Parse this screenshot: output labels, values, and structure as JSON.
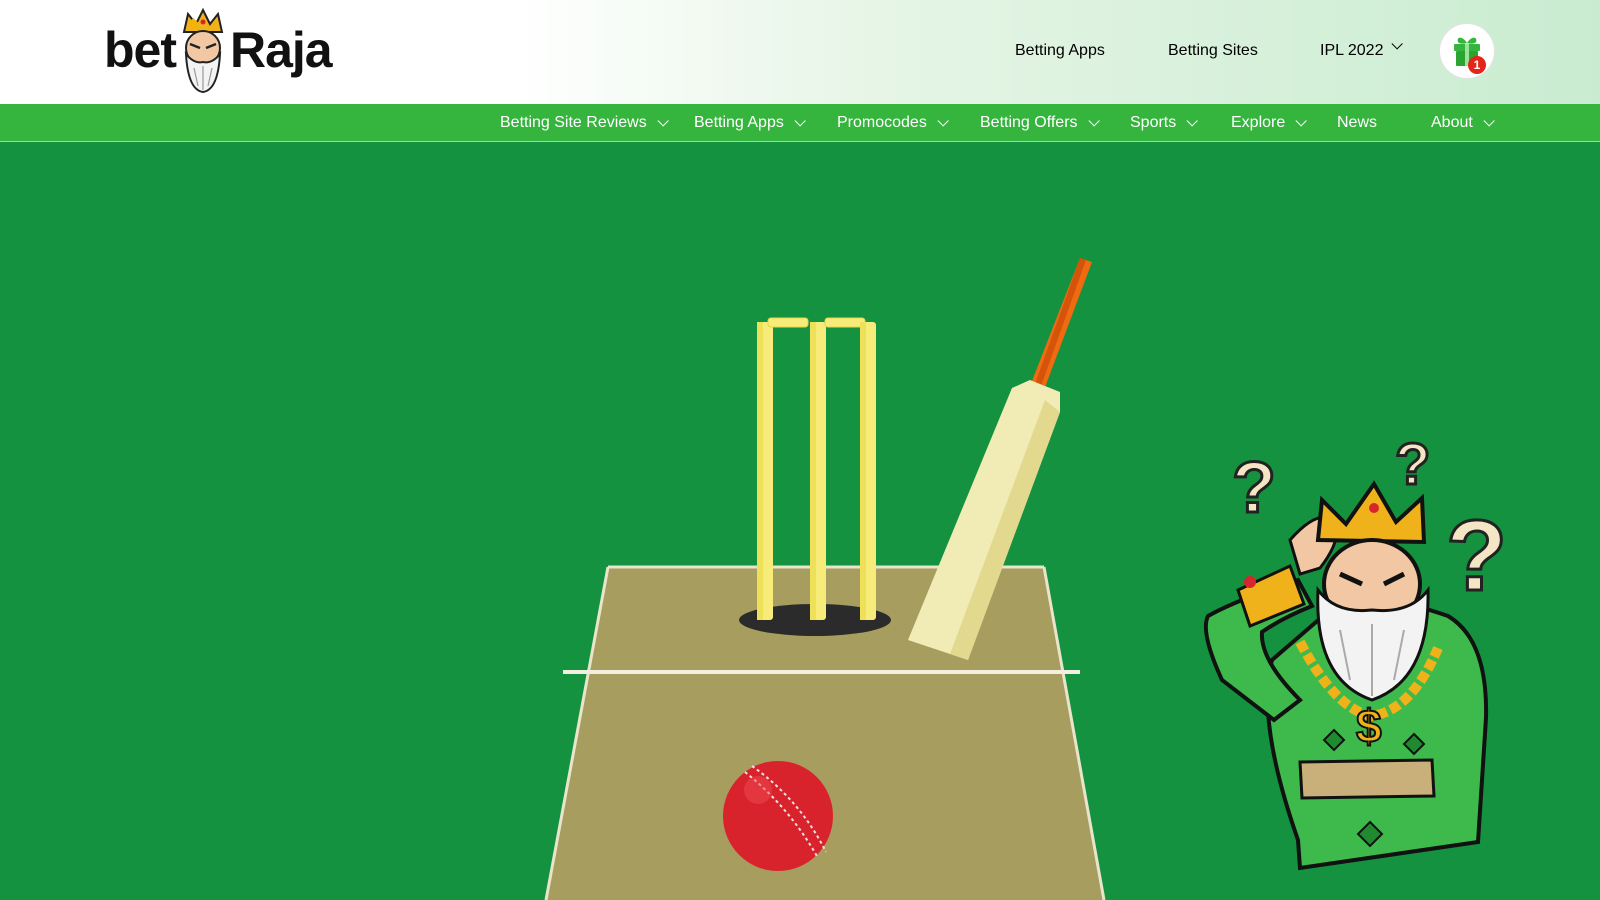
{
  "brand": {
    "logo_left": "bet",
    "logo_right": "Raja",
    "accent": "#35b53d",
    "hero_bg": "#14923f"
  },
  "top_nav": {
    "items": [
      {
        "label": "Betting Apps",
        "has_dropdown": false
      },
      {
        "label": "Betting Sites",
        "has_dropdown": false
      },
      {
        "label": "IPL 2022",
        "has_dropdown": true
      }
    ],
    "gift": {
      "icon": "gift-icon",
      "badge": "1"
    }
  },
  "main_nav": {
    "items": [
      {
        "label": "Betting Site Reviews",
        "has_dropdown": true
      },
      {
        "label": "Betting Apps",
        "has_dropdown": true
      },
      {
        "label": "Promocodes",
        "has_dropdown": true
      },
      {
        "label": "Betting Offers",
        "has_dropdown": true
      },
      {
        "label": "Sports",
        "has_dropdown": true
      },
      {
        "label": "Explore",
        "has_dropdown": true
      },
      {
        "label": "News",
        "has_dropdown": false
      },
      {
        "label": "About",
        "has_dropdown": true
      }
    ]
  },
  "hero": {
    "illustration": "cricket-pitch-illustration",
    "mascot": "confused-king-mascot"
  }
}
